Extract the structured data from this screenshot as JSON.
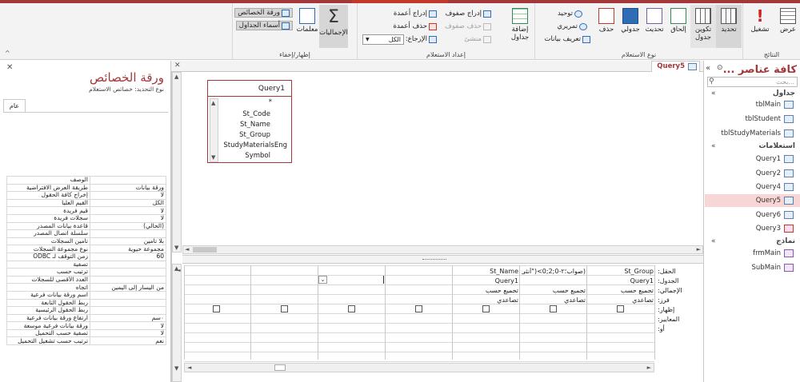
{
  "ribbon": {
    "results": {
      "title": "النتائج",
      "view": "عرض",
      "run": "تشغيل"
    },
    "query_type": {
      "title": "نوع الاستعلام",
      "select": "تحديد",
      "make_table": "تكوين جدول",
      "append": "إلحاق",
      "update": "تحديث",
      "crosstab": "جدولي",
      "delete": "حذف",
      "union": "توحيد",
      "passthrough": "تمريري",
      "data_def": "تعريف بيانات"
    },
    "setup": {
      "title": "إعداد الاستعلام",
      "add_tables": "إضافة جداول",
      "insert_rows": "إدراج صفوف",
      "delete_rows": "حذف صفوف",
      "builder": "منشئ",
      "insert_cols": "إدراج أعمدة",
      "delete_cols": "حذف أعمدة",
      "return_label": "الإرجاع:",
      "return_value": "الكل"
    },
    "show_hide": {
      "title": "إظهار/إخفاء",
      "totals": "الإجماليات",
      "params": "معلمات",
      "prop_sheet": "ورقة الخصائص",
      "table_names": "أسماء الجداول"
    }
  },
  "nav": {
    "title": "كافة عناصر ...",
    "search_placeholder": "بحث...",
    "sections": [
      {
        "name": "جداول",
        "items": [
          "tblMain",
          "tblStudent",
          "tblStudyMaterials"
        ]
      },
      {
        "name": "استعلامات",
        "items": [
          "Query1",
          "Query2",
          "Query4",
          "Query5",
          "Query6",
          "Query3"
        ]
      },
      {
        "name": "نماذج",
        "items": [
          "frmMain",
          "SubMain"
        ]
      }
    ],
    "selected": "Query5"
  },
  "doc": {
    "tab_label": "Query5",
    "table_box": {
      "title": "Query1",
      "fields": [
        "*",
        "St_Code",
        "St_Name",
        "St_Group",
        "StudyMaterialsEng",
        "Symbol"
      ]
    }
  },
  "grid": {
    "row_labels": [
      "الحقل:",
      "الجدول:",
      "الإجمالي:",
      "فرز:",
      "إظهار:",
      "المعايير:",
      "أو:"
    ],
    "columns": [
      {
        "field": "St_Group",
        "table": "Query1",
        "total": "تجميع حسب",
        "sort": "تصاعدي"
      },
      {
        "field": "(صواب؛٢-0;2;0>(\"أنثى\";]",
        "table": "",
        "total": "تجميع حسب",
        "sort": "تصاعدي"
      },
      {
        "field": "St_Name",
        "table": "Query1",
        "total": "تجميع حسب",
        "sort": "تصاعدي"
      }
    ]
  },
  "props": {
    "title": "ورقة الخصائص",
    "subtitle": "نوع التحديد: خصائص الاستعلام",
    "tab": "عام",
    "rows": [
      [
        "الوصف",
        ""
      ],
      [
        "طريقة العرض الافتراضية",
        "ورقة بيانات"
      ],
      [
        "إخراج كافة الحقول",
        "لا"
      ],
      [
        "القيم العليا",
        "الكل"
      ],
      [
        "قيم فريدة",
        "لا"
      ],
      [
        "سجلات فريدة",
        "لا"
      ],
      [
        "قاعدة بيانات المصدر",
        "(الحالي)"
      ],
      [
        "سلسلة اتصال المصدر",
        ""
      ],
      [
        "تأمين السجلات",
        "بلا تأمين"
      ],
      [
        "نوع مجموعة السجلات",
        "مجموعة حيوية"
      ],
      [
        "زمن التوقف لـ ODBC",
        "60"
      ],
      [
        "تصفية",
        ""
      ],
      [
        "ترتيب حسب",
        ""
      ],
      [
        "العدد الأقصى للسجلات",
        ""
      ],
      [
        "اتجاه",
        "من اليسار إلى اليمين"
      ],
      [
        "اسم ورقة بيانات فرعية",
        ""
      ],
      [
        "ربط الحقول التابعة",
        ""
      ],
      [
        "ربط الحقول الرئيسية",
        ""
      ],
      [
        "ارتفاع ورقة بيانات فرعية",
        "٠سم"
      ],
      [
        "ورقة بيانات فرعية موسعة",
        "لا"
      ],
      [
        "تصفية حسب التحميل",
        "لا"
      ],
      [
        "ترتيب حسب تشغيل التحميل",
        "نعم"
      ]
    ]
  }
}
